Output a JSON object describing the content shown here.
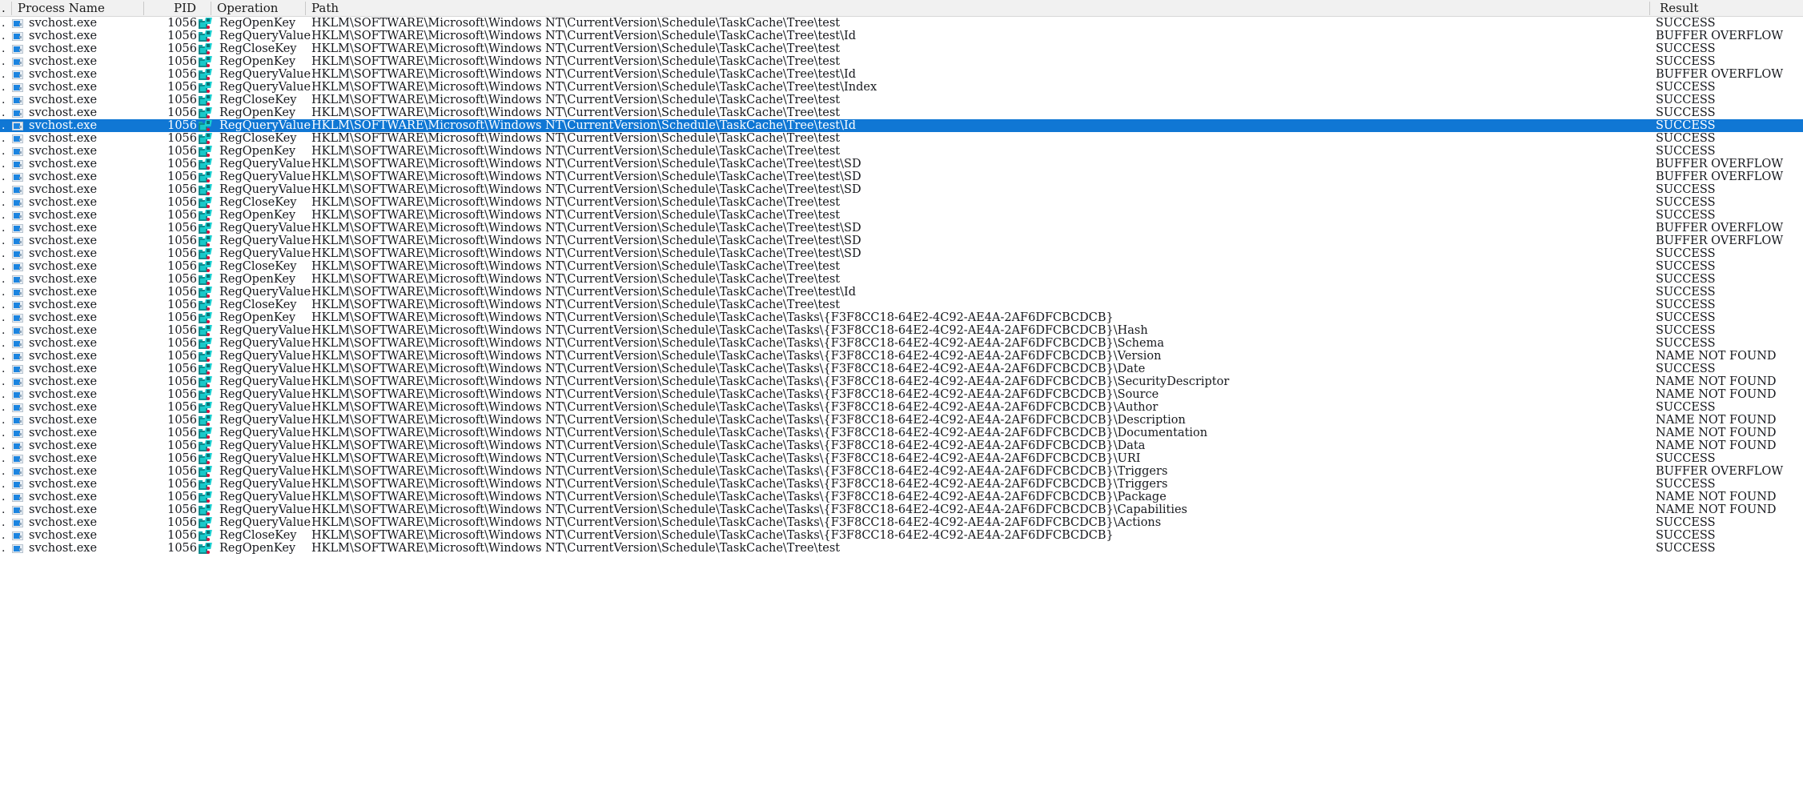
{
  "app": {
    "name": "process-monitor",
    "selection_color": "#1077d4",
    "header_bg": "#f1f1f1"
  },
  "columns": {
    "leading_marker": ".",
    "process_name": "Process Name",
    "pid": "PID",
    "operation": "Operation",
    "path": "Path",
    "result": "Result"
  },
  "icons": {
    "process": "application-window-icon",
    "operation": "registry-key-icon"
  },
  "rows": [
    {
      "process": "svchost.exe",
      "pid": "1056",
      "operation": "RegOpenKey",
      "path": "HKLM\\SOFTWARE\\Microsoft\\Windows NT\\CurrentVersion\\Schedule\\TaskCache\\Tree\\test",
      "result": "SUCCESS",
      "selected": false
    },
    {
      "process": "svchost.exe",
      "pid": "1056",
      "operation": "RegQueryValue",
      "path": "HKLM\\SOFTWARE\\Microsoft\\Windows NT\\CurrentVersion\\Schedule\\TaskCache\\Tree\\test\\Id",
      "result": "BUFFER OVERFLOW",
      "selected": false
    },
    {
      "process": "svchost.exe",
      "pid": "1056",
      "operation": "RegCloseKey",
      "path": "HKLM\\SOFTWARE\\Microsoft\\Windows NT\\CurrentVersion\\Schedule\\TaskCache\\Tree\\test",
      "result": "SUCCESS",
      "selected": false
    },
    {
      "process": "svchost.exe",
      "pid": "1056",
      "operation": "RegOpenKey",
      "path": "HKLM\\SOFTWARE\\Microsoft\\Windows NT\\CurrentVersion\\Schedule\\TaskCache\\Tree\\test",
      "result": "SUCCESS",
      "selected": false
    },
    {
      "process": "svchost.exe",
      "pid": "1056",
      "operation": "RegQueryValue",
      "path": "HKLM\\SOFTWARE\\Microsoft\\Windows NT\\CurrentVersion\\Schedule\\TaskCache\\Tree\\test\\Id",
      "result": "BUFFER OVERFLOW",
      "selected": false
    },
    {
      "process": "svchost.exe",
      "pid": "1056",
      "operation": "RegQueryValue",
      "path": "HKLM\\SOFTWARE\\Microsoft\\Windows NT\\CurrentVersion\\Schedule\\TaskCache\\Tree\\test\\Index",
      "result": "SUCCESS",
      "selected": false
    },
    {
      "process": "svchost.exe",
      "pid": "1056",
      "operation": "RegCloseKey",
      "path": "HKLM\\SOFTWARE\\Microsoft\\Windows NT\\CurrentVersion\\Schedule\\TaskCache\\Tree\\test",
      "result": "SUCCESS",
      "selected": false
    },
    {
      "process": "svchost.exe",
      "pid": "1056",
      "operation": "RegOpenKey",
      "path": "HKLM\\SOFTWARE\\Microsoft\\Windows NT\\CurrentVersion\\Schedule\\TaskCache\\Tree\\test",
      "result": "SUCCESS",
      "selected": false
    },
    {
      "process": "svchost.exe",
      "pid": "1056",
      "operation": "RegQueryValue",
      "path": "HKLM\\SOFTWARE\\Microsoft\\Windows NT\\CurrentVersion\\Schedule\\TaskCache\\Tree\\test\\Id",
      "result": "SUCCESS",
      "selected": true
    },
    {
      "process": "svchost.exe",
      "pid": "1056",
      "operation": "RegCloseKey",
      "path": "HKLM\\SOFTWARE\\Microsoft\\Windows NT\\CurrentVersion\\Schedule\\TaskCache\\Tree\\test",
      "result": "SUCCESS",
      "selected": false
    },
    {
      "process": "svchost.exe",
      "pid": "1056",
      "operation": "RegOpenKey",
      "path": "HKLM\\SOFTWARE\\Microsoft\\Windows NT\\CurrentVersion\\Schedule\\TaskCache\\Tree\\test",
      "result": "SUCCESS",
      "selected": false
    },
    {
      "process": "svchost.exe",
      "pid": "1056",
      "operation": "RegQueryValue",
      "path": "HKLM\\SOFTWARE\\Microsoft\\Windows NT\\CurrentVersion\\Schedule\\TaskCache\\Tree\\test\\SD",
      "result": "BUFFER OVERFLOW",
      "selected": false
    },
    {
      "process": "svchost.exe",
      "pid": "1056",
      "operation": "RegQueryValue",
      "path": "HKLM\\SOFTWARE\\Microsoft\\Windows NT\\CurrentVersion\\Schedule\\TaskCache\\Tree\\test\\SD",
      "result": "BUFFER OVERFLOW",
      "selected": false
    },
    {
      "process": "svchost.exe",
      "pid": "1056",
      "operation": "RegQueryValue",
      "path": "HKLM\\SOFTWARE\\Microsoft\\Windows NT\\CurrentVersion\\Schedule\\TaskCache\\Tree\\test\\SD",
      "result": "SUCCESS",
      "selected": false
    },
    {
      "process": "svchost.exe",
      "pid": "1056",
      "operation": "RegCloseKey",
      "path": "HKLM\\SOFTWARE\\Microsoft\\Windows NT\\CurrentVersion\\Schedule\\TaskCache\\Tree\\test",
      "result": "SUCCESS",
      "selected": false
    },
    {
      "process": "svchost.exe",
      "pid": "1056",
      "operation": "RegOpenKey",
      "path": "HKLM\\SOFTWARE\\Microsoft\\Windows NT\\CurrentVersion\\Schedule\\TaskCache\\Tree\\test",
      "result": "SUCCESS",
      "selected": false
    },
    {
      "process": "svchost.exe",
      "pid": "1056",
      "operation": "RegQueryValue",
      "path": "HKLM\\SOFTWARE\\Microsoft\\Windows NT\\CurrentVersion\\Schedule\\TaskCache\\Tree\\test\\SD",
      "result": "BUFFER OVERFLOW",
      "selected": false
    },
    {
      "process": "svchost.exe",
      "pid": "1056",
      "operation": "RegQueryValue",
      "path": "HKLM\\SOFTWARE\\Microsoft\\Windows NT\\CurrentVersion\\Schedule\\TaskCache\\Tree\\test\\SD",
      "result": "BUFFER OVERFLOW",
      "selected": false
    },
    {
      "process": "svchost.exe",
      "pid": "1056",
      "operation": "RegQueryValue",
      "path": "HKLM\\SOFTWARE\\Microsoft\\Windows NT\\CurrentVersion\\Schedule\\TaskCache\\Tree\\test\\SD",
      "result": "SUCCESS",
      "selected": false
    },
    {
      "process": "svchost.exe",
      "pid": "1056",
      "operation": "RegCloseKey",
      "path": "HKLM\\SOFTWARE\\Microsoft\\Windows NT\\CurrentVersion\\Schedule\\TaskCache\\Tree\\test",
      "result": "SUCCESS",
      "selected": false
    },
    {
      "process": "svchost.exe",
      "pid": "1056",
      "operation": "RegOpenKey",
      "path": "HKLM\\SOFTWARE\\Microsoft\\Windows NT\\CurrentVersion\\Schedule\\TaskCache\\Tree\\test",
      "result": "SUCCESS",
      "selected": false
    },
    {
      "process": "svchost.exe",
      "pid": "1056",
      "operation": "RegQueryValue",
      "path": "HKLM\\SOFTWARE\\Microsoft\\Windows NT\\CurrentVersion\\Schedule\\TaskCache\\Tree\\test\\Id",
      "result": "SUCCESS",
      "selected": false
    },
    {
      "process": "svchost.exe",
      "pid": "1056",
      "operation": "RegCloseKey",
      "path": "HKLM\\SOFTWARE\\Microsoft\\Windows NT\\CurrentVersion\\Schedule\\TaskCache\\Tree\\test",
      "result": "SUCCESS",
      "selected": false
    },
    {
      "process": "svchost.exe",
      "pid": "1056",
      "operation": "RegOpenKey",
      "path": "HKLM\\SOFTWARE\\Microsoft\\Windows NT\\CurrentVersion\\Schedule\\TaskCache\\Tasks\\{F3F8CC18-64E2-4C92-AE4A-2AF6DFCBCDCB}",
      "result": "SUCCESS",
      "selected": false
    },
    {
      "process": "svchost.exe",
      "pid": "1056",
      "operation": "RegQueryValue",
      "path": "HKLM\\SOFTWARE\\Microsoft\\Windows NT\\CurrentVersion\\Schedule\\TaskCache\\Tasks\\{F3F8CC18-64E2-4C92-AE4A-2AF6DFCBCDCB}\\Hash",
      "result": "SUCCESS",
      "selected": false
    },
    {
      "process": "svchost.exe",
      "pid": "1056",
      "operation": "RegQueryValue",
      "path": "HKLM\\SOFTWARE\\Microsoft\\Windows NT\\CurrentVersion\\Schedule\\TaskCache\\Tasks\\{F3F8CC18-64E2-4C92-AE4A-2AF6DFCBCDCB}\\Schema",
      "result": "SUCCESS",
      "selected": false
    },
    {
      "process": "svchost.exe",
      "pid": "1056",
      "operation": "RegQueryValue",
      "path": "HKLM\\SOFTWARE\\Microsoft\\Windows NT\\CurrentVersion\\Schedule\\TaskCache\\Tasks\\{F3F8CC18-64E2-4C92-AE4A-2AF6DFCBCDCB}\\Version",
      "result": "NAME NOT FOUND",
      "selected": false
    },
    {
      "process": "svchost.exe",
      "pid": "1056",
      "operation": "RegQueryValue",
      "path": "HKLM\\SOFTWARE\\Microsoft\\Windows NT\\CurrentVersion\\Schedule\\TaskCache\\Tasks\\{F3F8CC18-64E2-4C92-AE4A-2AF6DFCBCDCB}\\Date",
      "result": "SUCCESS",
      "selected": false
    },
    {
      "process": "svchost.exe",
      "pid": "1056",
      "operation": "RegQueryValue",
      "path": "HKLM\\SOFTWARE\\Microsoft\\Windows NT\\CurrentVersion\\Schedule\\TaskCache\\Tasks\\{F3F8CC18-64E2-4C92-AE4A-2AF6DFCBCDCB}\\SecurityDescriptor",
      "result": "NAME NOT FOUND",
      "selected": false
    },
    {
      "process": "svchost.exe",
      "pid": "1056",
      "operation": "RegQueryValue",
      "path": "HKLM\\SOFTWARE\\Microsoft\\Windows NT\\CurrentVersion\\Schedule\\TaskCache\\Tasks\\{F3F8CC18-64E2-4C92-AE4A-2AF6DFCBCDCB}\\Source",
      "result": "NAME NOT FOUND",
      "selected": false
    },
    {
      "process": "svchost.exe",
      "pid": "1056",
      "operation": "RegQueryValue",
      "path": "HKLM\\SOFTWARE\\Microsoft\\Windows NT\\CurrentVersion\\Schedule\\TaskCache\\Tasks\\{F3F8CC18-64E2-4C92-AE4A-2AF6DFCBCDCB}\\Author",
      "result": "SUCCESS",
      "selected": false
    },
    {
      "process": "svchost.exe",
      "pid": "1056",
      "operation": "RegQueryValue",
      "path": "HKLM\\SOFTWARE\\Microsoft\\Windows NT\\CurrentVersion\\Schedule\\TaskCache\\Tasks\\{F3F8CC18-64E2-4C92-AE4A-2AF6DFCBCDCB}\\Description",
      "result": "NAME NOT FOUND",
      "selected": false
    },
    {
      "process": "svchost.exe",
      "pid": "1056",
      "operation": "RegQueryValue",
      "path": "HKLM\\SOFTWARE\\Microsoft\\Windows NT\\CurrentVersion\\Schedule\\TaskCache\\Tasks\\{F3F8CC18-64E2-4C92-AE4A-2AF6DFCBCDCB}\\Documentation",
      "result": "NAME NOT FOUND",
      "selected": false
    },
    {
      "process": "svchost.exe",
      "pid": "1056",
      "operation": "RegQueryValue",
      "path": "HKLM\\SOFTWARE\\Microsoft\\Windows NT\\CurrentVersion\\Schedule\\TaskCache\\Tasks\\{F3F8CC18-64E2-4C92-AE4A-2AF6DFCBCDCB}\\Data",
      "result": "NAME NOT FOUND",
      "selected": false
    },
    {
      "process": "svchost.exe",
      "pid": "1056",
      "operation": "RegQueryValue",
      "path": "HKLM\\SOFTWARE\\Microsoft\\Windows NT\\CurrentVersion\\Schedule\\TaskCache\\Tasks\\{F3F8CC18-64E2-4C92-AE4A-2AF6DFCBCDCB}\\URI",
      "result": "SUCCESS",
      "selected": false
    },
    {
      "process": "svchost.exe",
      "pid": "1056",
      "operation": "RegQueryValue",
      "path": "HKLM\\SOFTWARE\\Microsoft\\Windows NT\\CurrentVersion\\Schedule\\TaskCache\\Tasks\\{F3F8CC18-64E2-4C92-AE4A-2AF6DFCBCDCB}\\Triggers",
      "result": "BUFFER OVERFLOW",
      "selected": false
    },
    {
      "process": "svchost.exe",
      "pid": "1056",
      "operation": "RegQueryValue",
      "path": "HKLM\\SOFTWARE\\Microsoft\\Windows NT\\CurrentVersion\\Schedule\\TaskCache\\Tasks\\{F3F8CC18-64E2-4C92-AE4A-2AF6DFCBCDCB}\\Triggers",
      "result": "SUCCESS",
      "selected": false
    },
    {
      "process": "svchost.exe",
      "pid": "1056",
      "operation": "RegQueryValue",
      "path": "HKLM\\SOFTWARE\\Microsoft\\Windows NT\\CurrentVersion\\Schedule\\TaskCache\\Tasks\\{F3F8CC18-64E2-4C92-AE4A-2AF6DFCBCDCB}\\Package",
      "result": "NAME NOT FOUND",
      "selected": false
    },
    {
      "process": "svchost.exe",
      "pid": "1056",
      "operation": "RegQueryValue",
      "path": "HKLM\\SOFTWARE\\Microsoft\\Windows NT\\CurrentVersion\\Schedule\\TaskCache\\Tasks\\{F3F8CC18-64E2-4C92-AE4A-2AF6DFCBCDCB}\\Capabilities",
      "result": "NAME NOT FOUND",
      "selected": false
    },
    {
      "process": "svchost.exe",
      "pid": "1056",
      "operation": "RegQueryValue",
      "path": "HKLM\\SOFTWARE\\Microsoft\\Windows NT\\CurrentVersion\\Schedule\\TaskCache\\Tasks\\{F3F8CC18-64E2-4C92-AE4A-2AF6DFCBCDCB}\\Actions",
      "result": "SUCCESS",
      "selected": false
    },
    {
      "process": "svchost.exe",
      "pid": "1056",
      "operation": "RegCloseKey",
      "path": "HKLM\\SOFTWARE\\Microsoft\\Windows NT\\CurrentVersion\\Schedule\\TaskCache\\Tasks\\{F3F8CC18-64E2-4C92-AE4A-2AF6DFCBCDCB}",
      "result": "SUCCESS",
      "selected": false
    },
    {
      "process": "svchost.exe",
      "pid": "1056",
      "operation": "RegOpenKey",
      "path": "HKLM\\SOFTWARE\\Microsoft\\Windows NT\\CurrentVersion\\Schedule\\TaskCache\\Tree\\test",
      "result": "SUCCESS",
      "selected": false
    }
  ]
}
